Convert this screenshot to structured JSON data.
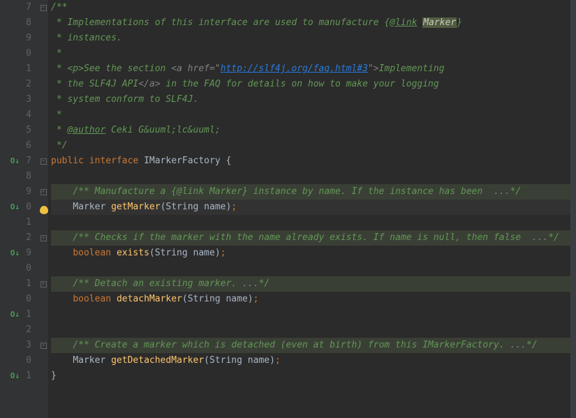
{
  "lineNumbers": [
    "7",
    "8",
    "9",
    "0",
    "1",
    "2",
    "3",
    "4",
    "5",
    "6",
    "7",
    "8",
    "9",
    "0",
    "1",
    "2",
    "9",
    "0",
    "1",
    "0",
    "1",
    "2",
    "3",
    "0",
    "1",
    ""
  ],
  "markers": {
    "6": "ov",
    "9": "ov",
    "12": "ov",
    "15": "ov",
    "18": "ov"
  },
  "foldIcons": {
    "0": "minus",
    "6": "minus",
    "8": "plus",
    "11": "plus",
    "14": "plus",
    "17": "plus"
  },
  "bulbRow": 9,
  "doc": {
    "open": "/**",
    "l1a": " * Implementations of this interface are used to manufacture {",
    "l1_link": "@link",
    "l1_sp": " ",
    "l1_marker": "Marker",
    "l1b": "}",
    "l2": " * instances.",
    "l3": " *",
    "l4a": " * <p>See the section ",
    "l4_dim": "<a href=\"",
    "l4_url": "http://slf4j.org/faq.html#3",
    "l4_dim2": "\">",
    "l4b": "Implementing",
    "l5a": " * the SLF4J API",
    "l5_dim": "</a>",
    "l5b": " in the FAQ for details on how to make your logging",
    "l6": " * system conform to SLF4J.",
    "l7": " *",
    "l8a": " * ",
    "l8_tag": "@author",
    "l8b": " Ceki G&uuml;lc&uuml;",
    "close": " */"
  },
  "decl": {
    "kw_public": "public",
    "kw_interface": "interface",
    "name": "IMarkerFactory",
    "brace_open": " {",
    "brace_close": "}"
  },
  "m1": {
    "doc": "/** Manufacture a {@link Marker} instance by name. If the instance has been ",
    "dots": " ...",
    "end": "*/",
    "ret": "Marker",
    "name": "getMarker",
    "sigOpen": "(",
    "ptype": "String",
    "pname": " name",
    "sigClose": ")",
    "semi": ";"
  },
  "m2": {
    "doc": "/** Checks if the marker with the name already exists. If name is null, then false ",
    "dots": " ...",
    "end": "*/",
    "ret": "boolean",
    "name": "exists",
    "sigOpen": "(",
    "ptype": "String",
    "pname": " name",
    "sigClose": ")",
    "semi": ";"
  },
  "m3": {
    "doc": "/** Detach an existing marker. ",
    "dots": "...",
    "end": "*/",
    "ret": "boolean",
    "name": "detachMarker",
    "sigOpen": "(",
    "ptype": "String",
    "pname": " name",
    "sigClose": ")",
    "semi": ";"
  },
  "m4": {
    "doc": "/** Create a marker which is detached (even at birth) from this IMarkerFactory. ",
    "dots": "...",
    "end": "*/",
    "ret": "Marker",
    "name": "getDetachedMarker",
    "sigOpen": "(",
    "ptype": "String",
    "pname": " name",
    "sigClose": ")",
    "semi": ";"
  },
  "blanks": {
    "empty": ""
  }
}
